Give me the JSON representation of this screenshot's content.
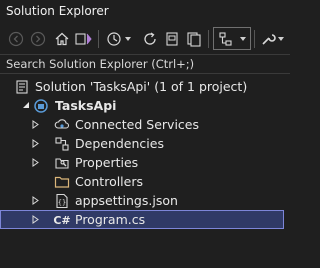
{
  "panel": {
    "title": "Solution Explorer"
  },
  "search": {
    "placeholder": "Search Solution Explorer (Ctrl+;)"
  },
  "tree": {
    "solution_label": "Solution 'TasksApi' (1 of 1 project)",
    "project_label": "TasksApi",
    "items": [
      {
        "label": "Connected Services",
        "icon": "connected-services-icon"
      },
      {
        "label": "Dependencies",
        "icon": "dependencies-icon"
      },
      {
        "label": "Properties",
        "icon": "properties-icon"
      },
      {
        "label": "Controllers",
        "icon": "folder-icon"
      },
      {
        "label": "appsettings.json",
        "icon": "json-file-icon"
      },
      {
        "label": "Program.cs",
        "icon": "csharp-file-icon",
        "csharp_badge": "C#"
      }
    ]
  },
  "colors": {
    "background": "#1f1f1f",
    "selection": "#303a66",
    "selection_border": "#7d86d8",
    "folder": "#dcb67a",
    "project_accent": "#5a9bd8"
  }
}
